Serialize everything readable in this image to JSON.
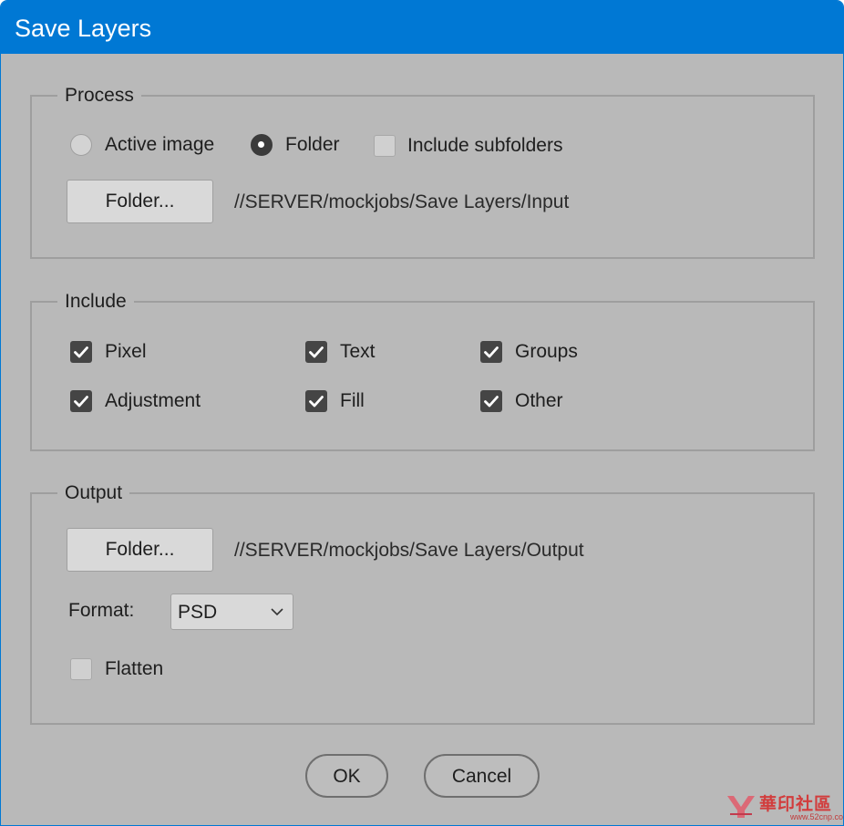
{
  "window": {
    "title": "Save Layers",
    "accent_color": "#0078d4"
  },
  "process": {
    "legend": "Process",
    "mode_options": [
      {
        "label": "Active image",
        "selected": false
      },
      {
        "label": "Folder",
        "selected": true
      }
    ],
    "include_subfolders": {
      "label": "Include subfolders",
      "checked": false
    },
    "folder_button": "Folder...",
    "input_path": "//SERVER/mockjobs/Save Layers/Input"
  },
  "include": {
    "legend": "Include",
    "items": [
      {
        "label": "Pixel",
        "checked": true
      },
      {
        "label": "Text",
        "checked": true
      },
      {
        "label": "Groups",
        "checked": true
      },
      {
        "label": "Adjustment",
        "checked": true
      },
      {
        "label": "Fill",
        "checked": true
      },
      {
        "label": "Other",
        "checked": true
      }
    ]
  },
  "output": {
    "legend": "Output",
    "folder_button": "Folder...",
    "output_path": "//SERVER/mockjobs/Save Layers/Output",
    "format_label": "Format:",
    "format_value": "PSD",
    "flatten": {
      "label": "Flatten",
      "checked": false
    }
  },
  "buttons": {
    "ok": "OK",
    "cancel": "Cancel"
  },
  "watermark": {
    "text": "華印社區",
    "url": "www.52cnp.com"
  }
}
